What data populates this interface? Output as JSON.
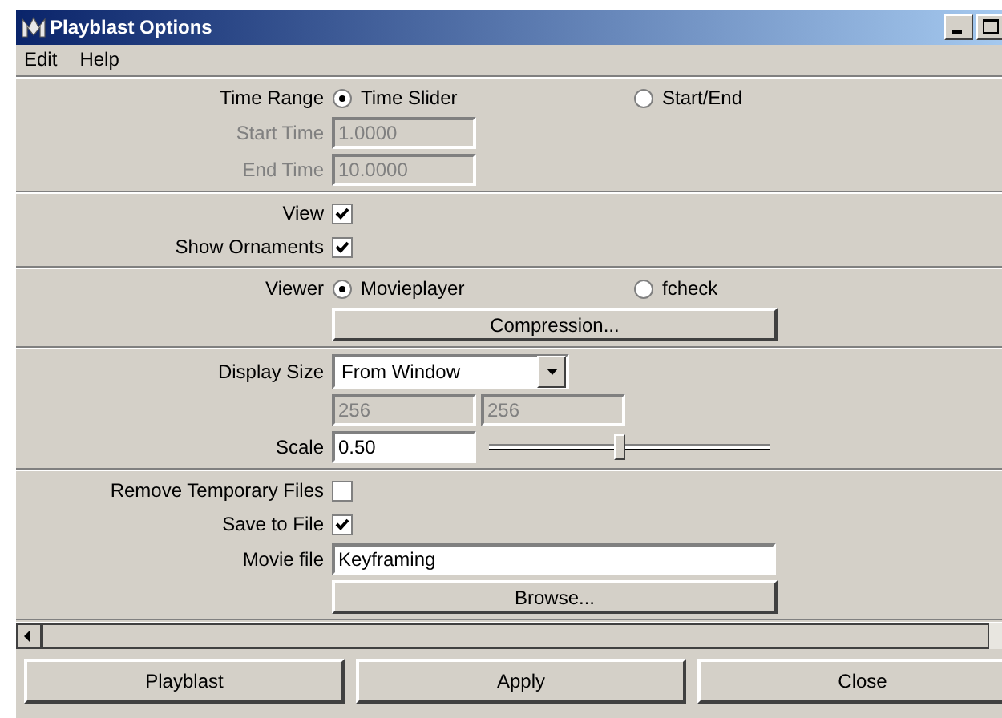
{
  "window": {
    "title": "Playblast Options"
  },
  "menu": [
    "Edit",
    "Help"
  ],
  "sections": [
    {
      "rows": [
        {
          "kind": "radio",
          "label": "Time Range",
          "options": [
            {
              "label": "Time Slider",
              "selected": true
            },
            {
              "label": "Start/End",
              "selected": false
            }
          ]
        },
        {
          "kind": "field",
          "label": "Start Time",
          "value": "1.0000",
          "disabled": true
        },
        {
          "kind": "field",
          "label": "End Time",
          "value": "10.0000",
          "disabled": true
        }
      ]
    },
    {
      "rows": [
        {
          "kind": "checkbox",
          "label": "View",
          "checked": true
        },
        {
          "kind": "checkbox",
          "label": "Show Ornaments",
          "checked": true
        }
      ]
    },
    {
      "rows": [
        {
          "kind": "radio",
          "label": "Viewer",
          "options": [
            {
              "label": "Movieplayer",
              "selected": true
            },
            {
              "label": "fcheck",
              "selected": false
            }
          ]
        },
        {
          "kind": "button",
          "label": "Compression..."
        }
      ]
    },
    {
      "rows": [
        {
          "kind": "dropdown",
          "label": "Display Size",
          "value": "From Window"
        },
        {
          "kind": "pair",
          "values": [
            "256",
            "256"
          ],
          "disabled": true
        },
        {
          "kind": "slider",
          "label": "Scale",
          "value": "0.50",
          "level": 0.46
        }
      ]
    },
    {
      "rows": [
        {
          "kind": "checkbox",
          "label": "Remove Temporary Files",
          "checked": false
        },
        {
          "kind": "checkbox",
          "label": "Save to File",
          "checked": true
        },
        {
          "kind": "field",
          "label": "Movie file",
          "value": "Keyframing",
          "disabled": false
        },
        {
          "kind": "button",
          "label": "Browse..."
        }
      ]
    }
  ],
  "buttons": [
    "Playblast",
    "Apply",
    "Close"
  ]
}
